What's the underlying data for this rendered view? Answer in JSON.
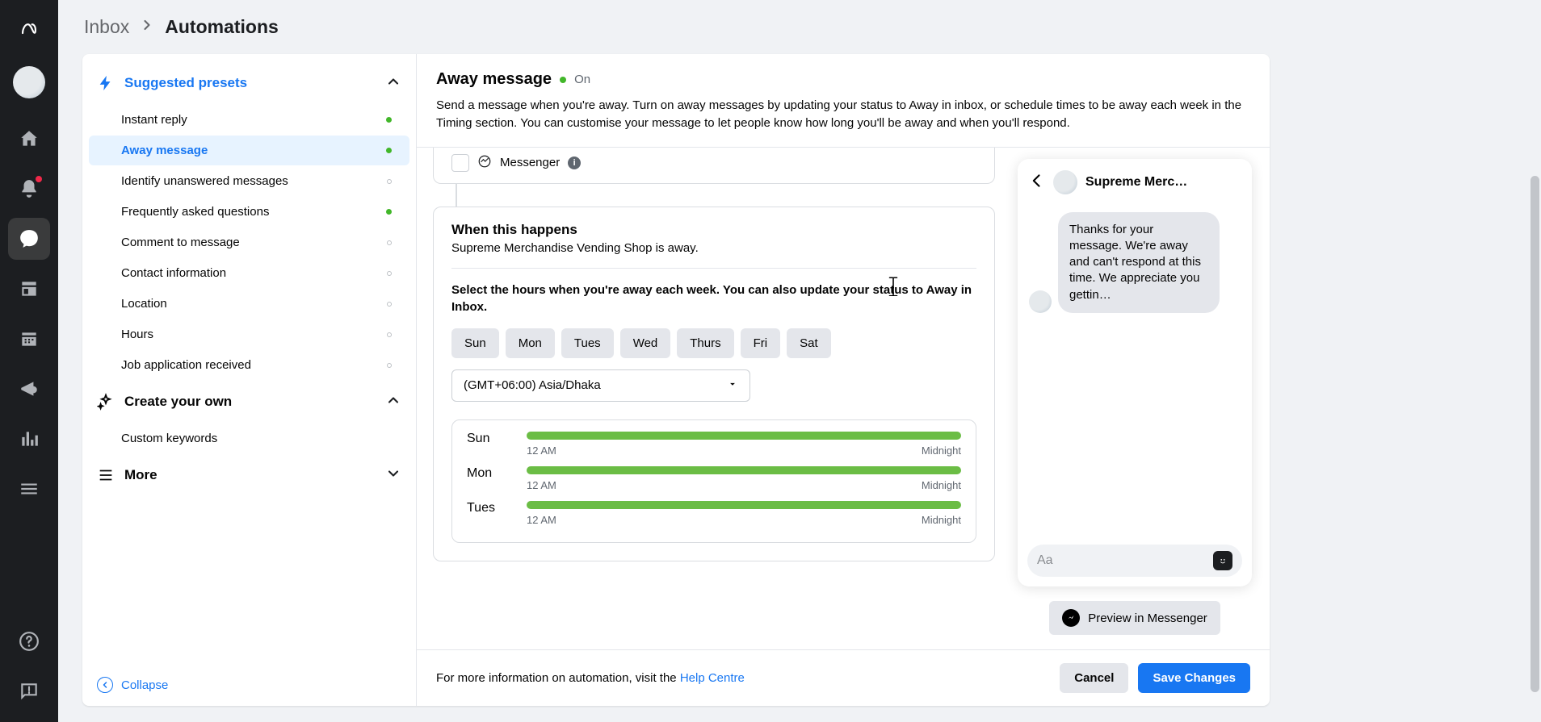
{
  "breadcrumb": {
    "parent": "Inbox",
    "current": "Automations"
  },
  "sidebar": {
    "suggested_label": "Suggested presets",
    "items": [
      {
        "label": "Instant reply",
        "status": "green"
      },
      {
        "label": "Away message",
        "status": "green",
        "active": true
      },
      {
        "label": "Identify unanswered messages",
        "status": "grey"
      },
      {
        "label": "Frequently asked questions",
        "status": "green"
      },
      {
        "label": "Comment to message",
        "status": "grey"
      },
      {
        "label": "Contact information",
        "status": "grey"
      },
      {
        "label": "Location",
        "status": "grey"
      },
      {
        "label": "Hours",
        "status": "grey"
      },
      {
        "label": "Job application received",
        "status": "grey"
      }
    ],
    "create_label": "Create your own",
    "create_items": [
      {
        "label": "Custom keywords"
      }
    ],
    "more_label": "More",
    "collapse_label": "Collapse"
  },
  "header": {
    "title": "Away message",
    "status_text": "On",
    "description": "Send a message when you're away. Turn on away messages by updating your status to Away in inbox, or schedule times to be away each week in the Timing section. You can customise your message to let people know how long you'll be away and when you'll respond."
  },
  "channel": {
    "messenger_label": "Messenger"
  },
  "when": {
    "title": "When this happens",
    "subtitle": "Supreme Merchandise Vending Shop is away.",
    "instruction": "Select the hours when you're away each week. You can also update your status to Away in Inbox.",
    "days": [
      "Sun",
      "Mon",
      "Tues",
      "Wed",
      "Thurs",
      "Fri",
      "Sat"
    ],
    "timezone": "(GMT+06:00) Asia/Dhaka",
    "schedule": [
      {
        "day": "Sun",
        "start_label": "12 AM",
        "end_label": "Midnight"
      },
      {
        "day": "Mon",
        "start_label": "12 AM",
        "end_label": "Midnight"
      },
      {
        "day": "Tues",
        "start_label": "12 AM",
        "end_label": "Midnight"
      }
    ]
  },
  "preview": {
    "shop_name": "Supreme Merc…",
    "bubble_text": "Thanks for your message. We're away and can't respond at this time. We appreciate you gettin…",
    "input_placeholder": "Aa",
    "preview_button": "Preview in Messenger"
  },
  "footer": {
    "info_prefix": "For more information on automation, visit the ",
    "link_text": "Help Centre",
    "cancel": "Cancel",
    "save": "Save Changes"
  }
}
